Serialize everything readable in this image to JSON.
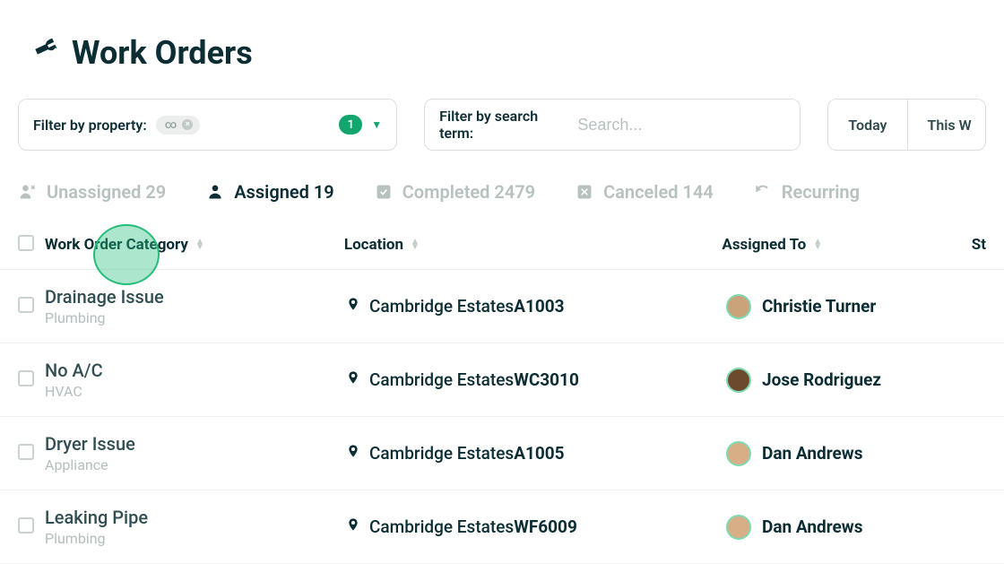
{
  "header": {
    "title": "Work Orders"
  },
  "filters": {
    "property_label": "Filter by property:",
    "chip_icon": "∞",
    "count": "1",
    "search_label": "Filter by search term:",
    "search_placeholder": "Search..."
  },
  "date_buttons": [
    "Today",
    "This W"
  ],
  "tabs": [
    {
      "key": "unassigned",
      "label": "Unassigned 29",
      "active": false
    },
    {
      "key": "assigned",
      "label": "Assigned 19",
      "active": true
    },
    {
      "key": "completed",
      "label": "Completed 2479",
      "active": false
    },
    {
      "key": "canceled",
      "label": "Canceled 144",
      "active": false
    },
    {
      "key": "recurring",
      "label": "Recurring",
      "active": false
    }
  ],
  "columns": {
    "category": "Work Order Category",
    "location": "Location",
    "assigned_to": "Assigned To",
    "status": "St"
  },
  "rows": [
    {
      "title": "Drainage Issue",
      "sub": "Plumbing",
      "loc": "Cambridge Estates",
      "unit": "A1003",
      "assignee": "Christie Turner",
      "avatar": "#caa37a"
    },
    {
      "title": "No A/C",
      "sub": "HVAC",
      "loc": "Cambridge Estates",
      "unit": "WC3010",
      "assignee": "Jose Rodriguez",
      "avatar": "#6b4a2e"
    },
    {
      "title": "Dryer Issue",
      "sub": "Appliance",
      "loc": "Cambridge Estates",
      "unit": "A1005",
      "assignee": "Dan Andrews",
      "avatar": "#d8ae86"
    },
    {
      "title": "Leaking Pipe",
      "sub": "Plumbing",
      "loc": "Cambridge Estates",
      "unit": "WF6009",
      "assignee": "Dan Andrews",
      "avatar": "#d8ae86"
    }
  ]
}
